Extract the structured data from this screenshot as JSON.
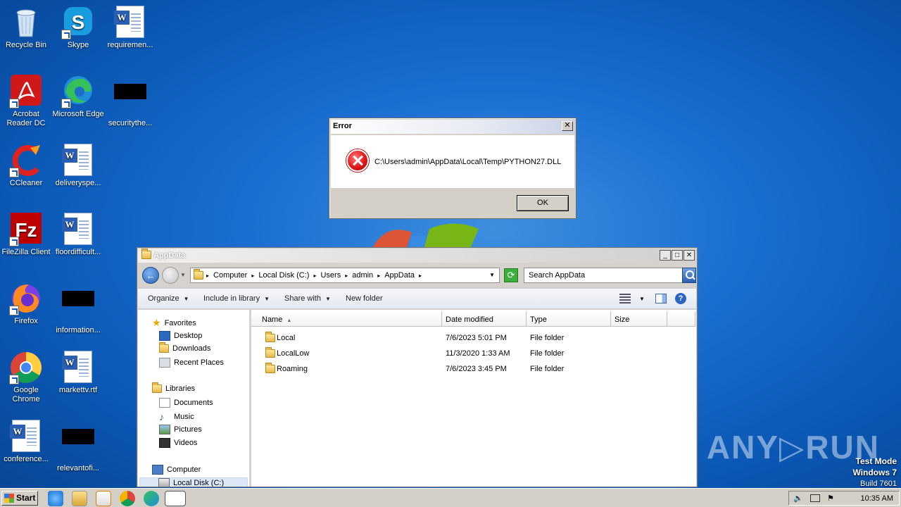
{
  "desktop": {
    "icons": [
      {
        "label": "Recycle Bin"
      },
      {
        "label": "Skype"
      },
      {
        "label": "requiremen..."
      },
      {
        "label": "Acrobat Reader DC"
      },
      {
        "label": "Microsoft Edge"
      },
      {
        "label": "securitythe..."
      },
      {
        "label": "CCleaner"
      },
      {
        "label": "deliveryspe..."
      },
      {
        "label": "FileZilla Client"
      },
      {
        "label": "floordifficult..."
      },
      {
        "label": "Firefox"
      },
      {
        "label": "information..."
      },
      {
        "label": "Google Chrome"
      },
      {
        "label": "markettv.rtf"
      },
      {
        "label": "conference..."
      },
      {
        "label": "relevantofi..."
      }
    ]
  },
  "error_dialog": {
    "title": "Error",
    "message": "C:\\Users\\admin\\AppData\\Local\\Temp\\PYTHON27.DLL",
    "ok_label": "OK",
    "close_glyph": "✕"
  },
  "explorer": {
    "title": "AppData",
    "breadcrumb": [
      "Computer",
      "Local Disk (C:)",
      "Users",
      "admin",
      "AppData"
    ],
    "search_placeholder": "Search AppData",
    "toolbar": {
      "organize": "Organize",
      "include_in_library": "Include in library",
      "share_with": "Share with",
      "new_folder": "New folder"
    },
    "nav": {
      "favorites": "Favorites",
      "desktop": "Desktop",
      "downloads": "Downloads",
      "recent_places": "Recent Places",
      "libraries": "Libraries",
      "documents": "Documents",
      "music": "Music",
      "pictures": "Pictures",
      "videos": "Videos",
      "computer": "Computer",
      "local_disk": "Local Disk (C:)"
    },
    "columns": {
      "name": "Name",
      "date_modified": "Date modified",
      "type": "Type",
      "size": "Size"
    },
    "rows": [
      {
        "name": "Local",
        "date": "7/6/2023 5:01 PM",
        "type": "File folder"
      },
      {
        "name": "LocalLow",
        "date": "11/3/2020 1:33 AM",
        "type": "File folder"
      },
      {
        "name": "Roaming",
        "date": "7/6/2023 3:45 PM",
        "type": "File folder"
      }
    ]
  },
  "watermark": {
    "brand": "ANY▷RUN",
    "test_mode": "Test Mode",
    "os": "Windows 7",
    "build": "Build 7601"
  },
  "taskbar": {
    "start_label": "Start",
    "clock": "10:35 AM"
  }
}
